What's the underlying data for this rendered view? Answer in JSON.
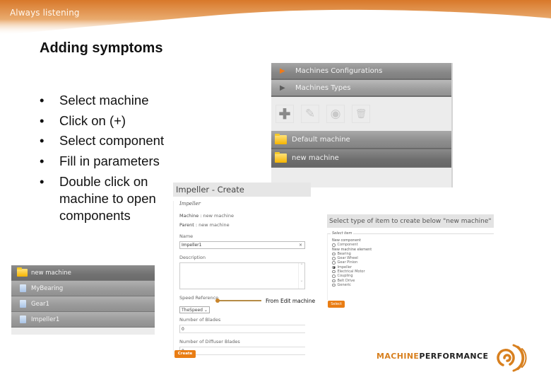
{
  "header": {
    "tagline": "Always listening",
    "accent": "#d8782a"
  },
  "slide": {
    "title": "Adding symptoms",
    "bullets": [
      "Select machine",
      "Click on (+)",
      "Select component",
      "Fill in parameters",
      "Double click on machine to open components"
    ]
  },
  "machine_config_panel": {
    "nav": [
      {
        "label": "Machines Configurations",
        "icon": "play-arrow-orange-icon"
      },
      {
        "label": "Machines Types",
        "icon": "play-arrow-gray-icon"
      }
    ],
    "toolbar": [
      {
        "icon": "add-icon",
        "glyph": "✚"
      },
      {
        "icon": "edit-icon",
        "glyph": "✎"
      },
      {
        "icon": "view-icon",
        "glyph": "◉"
      },
      {
        "icon": "delete-icon",
        "glyph": "🗑"
      }
    ],
    "machines": [
      "Default machine",
      "new machine"
    ]
  },
  "create_form": {
    "title": "Impeller - Create",
    "subtitle": "Impeller",
    "machine_label": "Machine :",
    "machine_value": "new machine",
    "parent_label": "Parent :",
    "parent_value": "new machine",
    "name_label": "Name",
    "name_value": "Impeller1",
    "description_label": "Description",
    "description_value": "",
    "speed_reference_label": "Speed Reference",
    "speed_reference_value": "TheSpeed",
    "blades_label": "Number of Blades",
    "blades_value": "0",
    "diffuser_label": "Number of Diffuser Blades",
    "diffuser_value": "0",
    "create_button": "Create"
  },
  "annotation": {
    "text": "From Edit machine"
  },
  "select_type_panel": {
    "title": "Select type of item to create below \"new machine\"",
    "legend": "Select item",
    "group1": "New component",
    "group1_options": [
      {
        "label": "Component",
        "selected": false
      }
    ],
    "group2": "New machine element",
    "group2_options": [
      {
        "label": "Bearing",
        "selected": false
      },
      {
        "label": "Gear Wheel",
        "selected": false
      },
      {
        "label": "Gear Pinion",
        "selected": false
      },
      {
        "label": "Impeller",
        "selected": true
      },
      {
        "label": "Electrical Motor",
        "selected": false
      },
      {
        "label": "Coupling",
        "selected": false
      },
      {
        "label": "Belt Drive",
        "selected": false
      },
      {
        "label": "Generic",
        "selected": false
      }
    ],
    "select_button": "Select"
  },
  "tree_panel": {
    "root": "new machine",
    "children": [
      "MyBearing",
      "Gear1",
      "Impeller1"
    ]
  },
  "logo": {
    "part1": "MACHINE",
    "part2": "PERFORMANCE"
  }
}
